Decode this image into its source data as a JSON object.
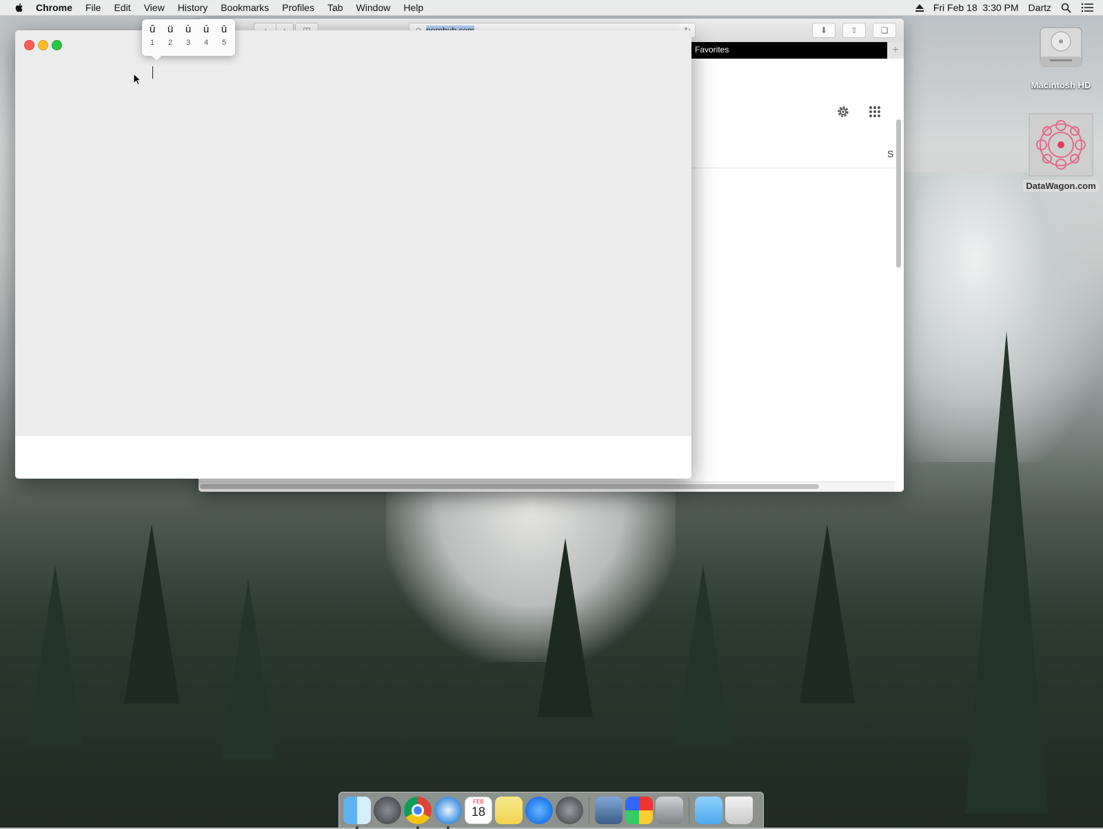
{
  "menubar": {
    "app_name": "Chrome",
    "items": [
      "File",
      "Edit",
      "View",
      "History",
      "Bookmarks",
      "Profiles",
      "Tab",
      "Window",
      "Help"
    ],
    "datetime": "Fri Feb 18  3:30 PM",
    "user": "Dartz"
  },
  "safari": {
    "address": "pornhub.com",
    "tab_label": "Favorites",
    "partial_text": "S"
  },
  "accent_popup": {
    "chars": [
      "û",
      "ü",
      "ù",
      "ú",
      "ū"
    ],
    "numbers": [
      "1",
      "2",
      "3",
      "4",
      "5"
    ]
  },
  "desktop": {
    "hd_label": "Macintosh HD",
    "site_label": "DataWagon.com"
  },
  "dock": {
    "calendar_month": "FEB",
    "calendar_day": "18"
  }
}
